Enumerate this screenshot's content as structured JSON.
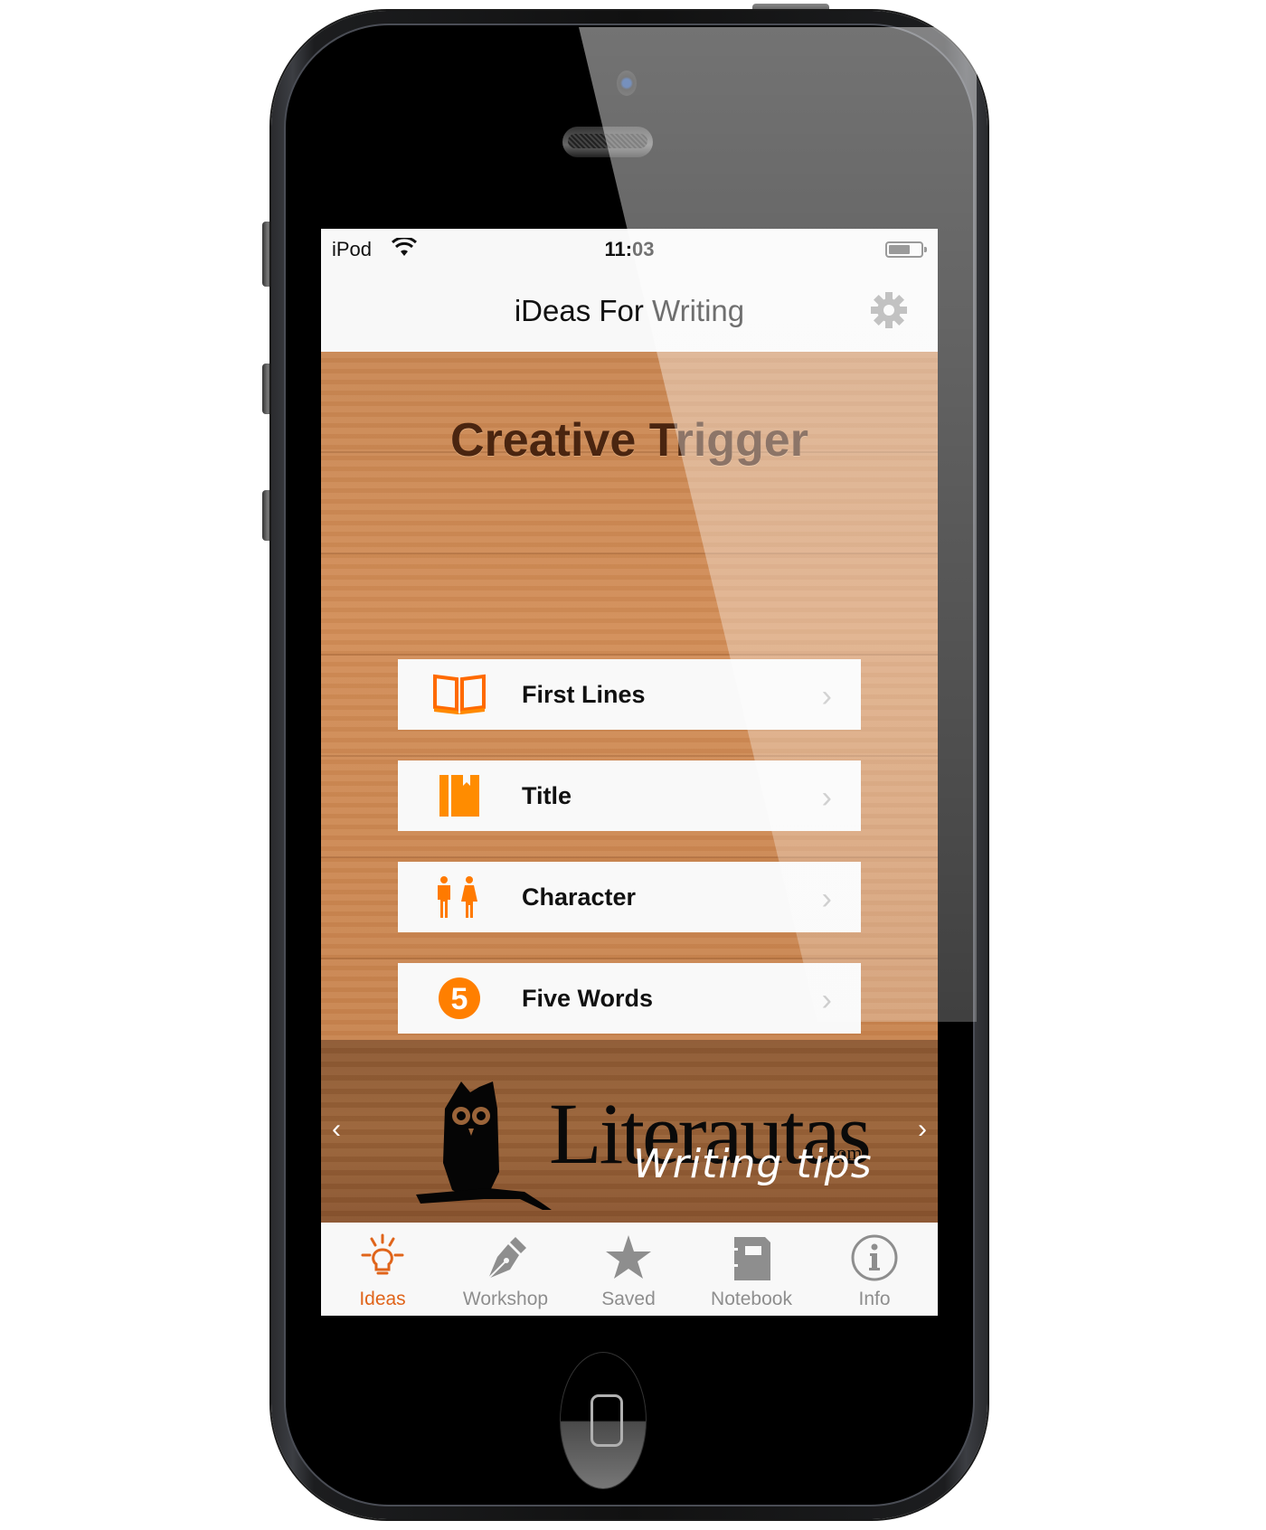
{
  "status_bar": {
    "carrier": "iPod",
    "time": "11:03",
    "wifi_icon": "wifi-icon",
    "battery_level": 0.7
  },
  "nav": {
    "title": "iDeas For Writing",
    "settings_icon": "gear-icon"
  },
  "hero": {
    "title": "Creative Trigger"
  },
  "menu": {
    "items": [
      {
        "label": "First Lines",
        "icon": "open-book-icon"
      },
      {
        "label": "Title",
        "icon": "bookmark-book-icon"
      },
      {
        "label": "Character",
        "icon": "people-icon"
      },
      {
        "label": "Five Words",
        "icon": "number-five-icon",
        "icon_text": "5"
      }
    ],
    "chevron": "›"
  },
  "banner": {
    "brand": "Literautas",
    "domain_suffix": ".com",
    "tagline": "Writing tips",
    "prev": "‹",
    "next": "›"
  },
  "tabbar": {
    "active": "Ideas",
    "items": [
      {
        "label": "Ideas",
        "icon": "lightbulb-icon"
      },
      {
        "label": "Workshop",
        "icon": "pen-nib-icon"
      },
      {
        "label": "Saved",
        "icon": "star-icon"
      },
      {
        "label": "Notebook",
        "icon": "notebook-icon"
      },
      {
        "label": "Info",
        "icon": "info-icon"
      }
    ]
  },
  "colors": {
    "accent": "#e0641a",
    "icon_orange": "#ff8a00",
    "tab_inactive": "#8e8e8e",
    "hero_text": "#4a2510"
  }
}
